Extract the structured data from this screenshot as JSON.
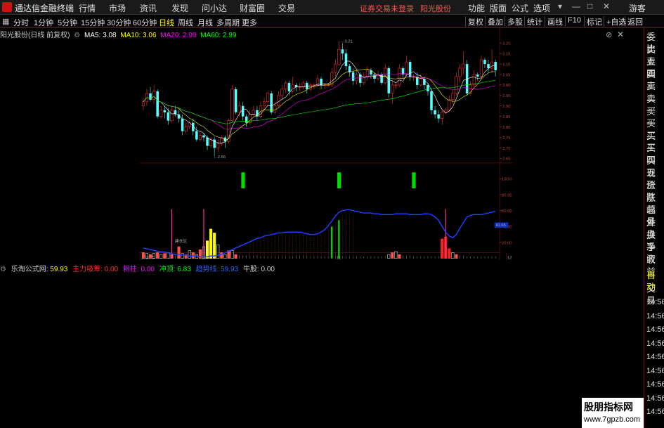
{
  "app": {
    "name": "通达信金融终端",
    "notice": "证券交易未登录",
    "stock": "阳光股份"
  },
  "menu": [
    "行情",
    "市场",
    "资讯",
    "发现",
    "问小达",
    "财富圈",
    "交易"
  ],
  "system_menu": [
    "功能",
    "版面",
    "公式",
    "选项"
  ],
  "guest_label": "游客",
  "periods": [
    {
      "label": "分时",
      "active": false
    },
    {
      "label": "1分钟",
      "active": false
    },
    {
      "label": "5分钟",
      "active": false
    },
    {
      "label": "15分钟",
      "active": false
    },
    {
      "label": "30分钟",
      "active": false
    },
    {
      "label": "60分钟",
      "active": false
    },
    {
      "label": "日线",
      "active": true
    },
    {
      "label": "周线",
      "active": false
    },
    {
      "label": "月线",
      "active": false
    },
    {
      "label": "多周期",
      "active": false
    },
    {
      "label": "更多",
      "active": false
    }
  ],
  "tools": [
    "复权",
    "叠加",
    "多股",
    "统计",
    "画线",
    "F10",
    "标记",
    "+自选",
    "返回"
  ],
  "main_info": {
    "title": "阳光股份(日线 前复权)",
    "ma5": "MA5: 3.08",
    "ma10": "MA10: 3.06",
    "ma20": "MA20: 2.99",
    "ma60": "MA60: 2.99",
    "colors": {
      "ma5": "#ffffff",
      "ma10": "#ffff00",
      "ma20": "#ff00ff",
      "ma60": "#00ff00"
    }
  },
  "annotations": {
    "high": "3.21",
    "low": "2.66",
    "build_zone": "建仓区"
  },
  "main_axis": [
    "3.20",
    "3.15",
    "3.10",
    "3.05",
    "3.00",
    "2.95",
    "2.90",
    "2.85",
    "2.80",
    "2.75",
    "2.70",
    "2.65"
  ],
  "sub_info": {
    "name": "乐淘公式网",
    "v1": ": 59.93",
    "v2": "主力吸筹: 0.00",
    "v3": "粉柱: 0.00",
    "v4": "冲顶: 6.83",
    "v5": "趋势线: 59.93",
    "v6": "牛股: 0.00"
  },
  "sub_axis": [
    "100.0",
    "80.00",
    "60.00",
    "40.00",
    "20.00"
  ],
  "current_value": "41.65",
  "date_labels": [
    "2023年",
    "10",
    "11",
    "12",
    "1"
  ],
  "right_panel": [
    "委比",
    "卖五",
    "卖四",
    "卖三",
    "卖二",
    "卖一",
    "买一",
    "买二",
    "买三",
    "买四",
    "买五",
    "现价",
    "涨跌",
    "涨幅",
    "总量",
    "外盘",
    "换手",
    "净资",
    "收益"
  ],
  "right_panel2": [
    "自动",
    "交易"
  ],
  "right_times": [
    "14:56",
    "14:56",
    "14:56",
    "14:56",
    "14:56",
    "14:56",
    "14:56",
    "14:56",
    "14:56"
  ],
  "watermark": {
    "line1": "股朋指标网",
    "line2": "www.7gpzb.com"
  },
  "chart_data": {
    "type": "candlestick",
    "ylim": [
      2.63,
      3.24
    ],
    "candles": [
      [
        2.9,
        2.92,
        2.88,
        2.94
      ],
      [
        2.92,
        2.96,
        2.9,
        2.98
      ],
      [
        2.96,
        2.93,
        2.92,
        2.99
      ],
      [
        2.93,
        2.97,
        2.91,
        3.0
      ],
      [
        2.97,
        2.85,
        2.84,
        2.98
      ],
      [
        2.85,
        2.88,
        2.84,
        2.9
      ],
      [
        2.88,
        2.87,
        2.84,
        2.9
      ],
      [
        2.87,
        2.83,
        2.81,
        2.89
      ],
      [
        2.83,
        2.88,
        2.82,
        2.9
      ],
      [
        2.88,
        2.86,
        2.85,
        2.9
      ],
      [
        2.86,
        2.84,
        2.82,
        2.88
      ],
      [
        2.84,
        2.78,
        2.76,
        2.86
      ],
      [
        2.78,
        2.8,
        2.77,
        2.82
      ],
      [
        2.8,
        2.82,
        2.79,
        2.83
      ],
      [
        2.82,
        2.78,
        2.76,
        2.84
      ],
      [
        2.78,
        2.74,
        2.73,
        2.8
      ],
      [
        2.74,
        2.76,
        2.73,
        2.78
      ],
      [
        2.76,
        2.75,
        2.73,
        2.77
      ],
      [
        2.75,
        2.71,
        2.69,
        2.76
      ],
      [
        2.71,
        2.74,
        2.7,
        2.75
      ],
      [
        2.74,
        2.7,
        2.66,
        2.75
      ],
      [
        2.7,
        2.72,
        2.68,
        2.74
      ],
      [
        2.72,
        2.75,
        2.71,
        2.76
      ],
      [
        2.75,
        2.73,
        2.7,
        2.76
      ],
      [
        2.73,
        2.83,
        2.72,
        2.84
      ],
      [
        2.83,
        2.98,
        2.82,
        3.0
      ],
      [
        2.98,
        2.87,
        2.86,
        2.99
      ],
      [
        2.87,
        2.9,
        2.85,
        2.92
      ],
      [
        2.9,
        2.85,
        2.83,
        2.92
      ],
      [
        2.85,
        2.82,
        2.8,
        2.86
      ],
      [
        2.82,
        2.86,
        2.81,
        2.88
      ],
      [
        2.86,
        2.88,
        2.85,
        2.9
      ],
      [
        2.88,
        2.85,
        2.83,
        2.9
      ],
      [
        2.85,
        2.9,
        2.84,
        2.92
      ],
      [
        2.9,
        2.92,
        2.88,
        2.94
      ],
      [
        2.92,
        2.96,
        2.9,
        2.97
      ],
      [
        2.96,
        2.87,
        2.86,
        2.97
      ],
      [
        2.87,
        2.9,
        2.86,
        2.92
      ],
      [
        2.9,
        2.95,
        2.89,
        2.97
      ],
      [
        2.95,
        2.98,
        2.93,
        3.0
      ],
      [
        2.98,
        3.01,
        2.96,
        3.02
      ],
      [
        3.01,
        2.97,
        2.95,
        3.02
      ],
      [
        2.97,
        3.0,
        2.96,
        3.04
      ],
      [
        3.0,
        2.99,
        2.97,
        3.01
      ],
      [
        2.99,
        2.99,
        2.97,
        3.01
      ],
      [
        2.99,
        3.01,
        2.98,
        3.02
      ],
      [
        3.01,
        2.98,
        2.96,
        3.02
      ],
      [
        2.98,
        3.0,
        2.97,
        3.01
      ],
      [
        3.0,
        3.0,
        2.98,
        3.01
      ],
      [
        3.0,
        3.03,
        2.99,
        3.05
      ],
      [
        3.03,
        3.0,
        2.98,
        3.04
      ],
      [
        3.0,
        3.0,
        2.98,
        3.01
      ],
      [
        3.0,
        3.0,
        2.99,
        3.01
      ],
      [
        3.0,
        3.06,
        2.99,
        3.08
      ],
      [
        3.06,
        3.1,
        3.04,
        3.12
      ],
      [
        3.1,
        3.17,
        3.09,
        3.21
      ],
      [
        3.17,
        3.15,
        3.12,
        3.2
      ],
      [
        3.15,
        3.09,
        3.07,
        3.17
      ],
      [
        3.09,
        3.06,
        3.04,
        3.1
      ],
      [
        3.06,
        3.02,
        3.0,
        3.08
      ],
      [
        3.02,
        3.05,
        3.0,
        3.07
      ],
      [
        3.05,
        3.01,
        2.99,
        3.06
      ],
      [
        3.01,
        3.04,
        3.0,
        3.06
      ],
      [
        3.04,
        3.07,
        3.02,
        3.09
      ],
      [
        3.07,
        3.05,
        3.03,
        3.08
      ],
      [
        3.05,
        3.03,
        3.01,
        3.06
      ],
      [
        3.03,
        3.05,
        3.02,
        3.07
      ],
      [
        3.05,
        3.01,
        3.0,
        3.06
      ],
      [
        3.01,
        3.08,
        3.0,
        3.1
      ],
      [
        3.08,
        2.96,
        2.94,
        3.09
      ],
      [
        2.96,
        3.0,
        2.91,
        3.02
      ],
      [
        3.0,
        3.0,
        2.98,
        3.01
      ],
      [
        3.0,
        3.08,
        2.99,
        3.1
      ],
      [
        3.08,
        3.05,
        3.03,
        3.09
      ],
      [
        3.05,
        3.11,
        3.04,
        3.14
      ],
      [
        3.11,
        3.04,
        3.02,
        3.12
      ],
      [
        3.04,
        3.04,
        3.02,
        3.05
      ],
      [
        3.04,
        3.0,
        2.98,
        3.06
      ],
      [
        3.0,
        3.03,
        2.99,
        3.05
      ],
      [
        3.03,
        3.0,
        2.98,
        3.04
      ],
      [
        3.0,
        2.97,
        2.95,
        3.01
      ],
      [
        2.97,
        2.88,
        2.86,
        2.98
      ],
      [
        2.88,
        2.86,
        2.84,
        2.9
      ],
      [
        2.86,
        2.84,
        2.82,
        2.88
      ],
      [
        2.84,
        2.87,
        2.81,
        2.88
      ],
      [
        2.87,
        2.88,
        2.86,
        2.89
      ],
      [
        2.88,
        2.93,
        2.87,
        2.95
      ],
      [
        2.93,
        2.96,
        2.91,
        2.98
      ],
      [
        2.96,
        3.04,
        2.95,
        3.06
      ],
      [
        3.04,
        3.08,
        3.01,
        3.1
      ],
      [
        3.08,
        3.1,
        3.05,
        3.16
      ],
      [
        3.1,
        2.96,
        2.95,
        3.12
      ],
      [
        2.96,
        3.0,
        2.95,
        3.02
      ],
      [
        3.0,
        3.05,
        2.99,
        3.07
      ],
      [
        3.05,
        3.04,
        3.02,
        3.06
      ],
      [
        3.04,
        3.12,
        3.03,
        3.14
      ],
      [
        3.12,
        3.1,
        3.08,
        3.13
      ],
      [
        3.1,
        3.08,
        3.06,
        3.12
      ],
      [
        3.08,
        3.11,
        3.06,
        3.17
      ],
      [
        3.11,
        3.07,
        3.04,
        3.12
      ]
    ],
    "sub_ylim": [
      0,
      110
    ],
    "trend_line": [
      13,
      12,
      11,
      10,
      9,
      8,
      8,
      7,
      6,
      5,
      5,
      4,
      4,
      3,
      3,
      3,
      2,
      2,
      2,
      3,
      3,
      4,
      5,
      7,
      9,
      11,
      13,
      15,
      17,
      19,
      21,
      23,
      25,
      26,
      28,
      29,
      30,
      31,
      32,
      32,
      33,
      33,
      33,
      33,
      33,
      32,
      31,
      30,
      30,
      31,
      33,
      36,
      41,
      47,
      53,
      58,
      60,
      61,
      61,
      60,
      59,
      58,
      57,
      57,
      57,
      56,
      56,
      55,
      55,
      55,
      55,
      56,
      56,
      56,
      56,
      55,
      55,
      55,
      55,
      56,
      56,
      55,
      52,
      48,
      40,
      33,
      28,
      26,
      30,
      38,
      45,
      52,
      54,
      55,
      55,
      55,
      56,
      57,
      58,
      59,
      59,
      60,
      61,
      60,
      59,
      59,
      59
    ],
    "signals_green": [
      28,
      55,
      76
    ],
    "pink_sticks": [
      8,
      17,
      85
    ],
    "volume_levels": [
      6,
      5,
      4,
      5,
      6,
      4,
      5,
      6,
      4,
      3,
      12,
      5,
      4,
      8,
      6,
      4,
      9,
      12,
      18,
      30,
      26,
      14,
      6,
      4,
      8,
      8,
      4,
      3,
      3,
      3,
      3,
      3,
      3,
      2,
      2,
      2,
      2,
      2,
      2,
      2,
      2,
      2,
      2,
      3,
      3,
      3,
      3,
      2,
      2,
      2,
      2,
      2,
      2,
      2,
      2,
      2,
      2,
      2,
      2,
      2,
      2,
      2,
      2,
      2,
      2,
      2,
      2,
      2,
      2,
      4,
      6,
      7,
      4,
      3,
      3,
      3,
      2,
      2,
      2,
      2,
      2,
      2,
      2,
      2,
      20,
      22,
      10,
      6,
      4,
      3,
      3,
      2,
      2,
      2,
      2,
      2,
      2,
      2,
      2,
      2,
      2
    ]
  }
}
